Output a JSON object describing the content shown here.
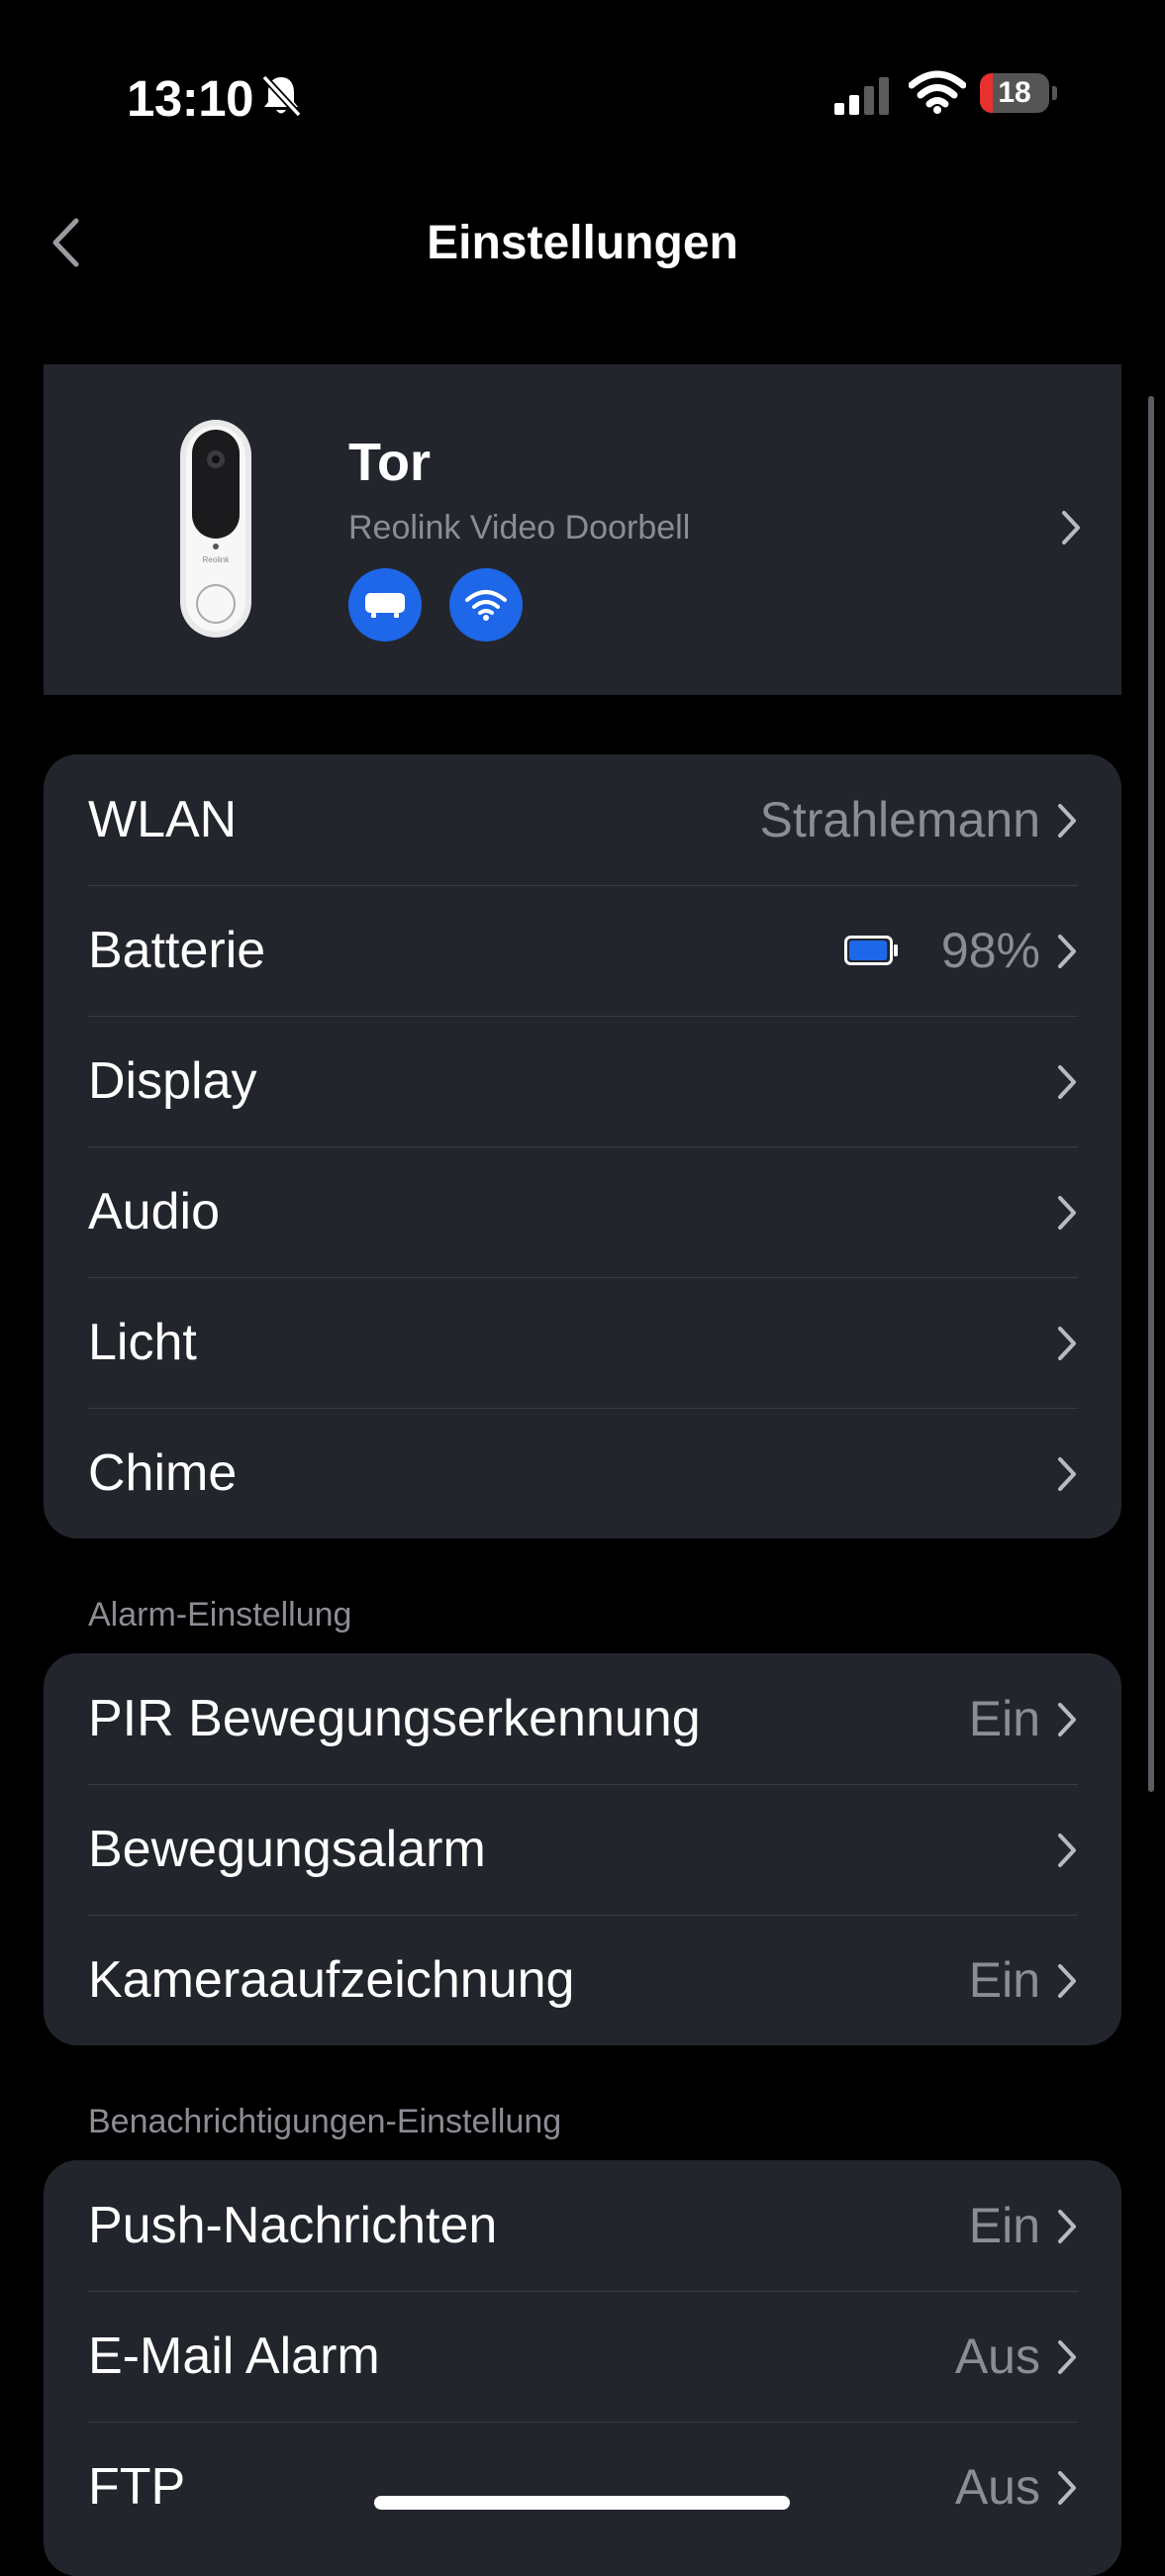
{
  "status_bar": {
    "time": "13:10",
    "battery_level": "18",
    "battery_fraction": 0.18,
    "battery_color": "#e8302e",
    "icons": [
      "bell-slash-icon",
      "cellular-signal-icon",
      "wifi-icon",
      "battery-icon"
    ]
  },
  "nav": {
    "title": "Einstellungen",
    "back_icon": "chevron-left-icon"
  },
  "device": {
    "name": "Tor",
    "model": "Reolink Video Doorbell",
    "image_brand": "Reolink",
    "badges": [
      "hub-icon",
      "wifi-icon"
    ],
    "badge_color": "#1d67e8"
  },
  "general": {
    "rows": [
      {
        "label": "WLAN",
        "value": "Strahlemann"
      },
      {
        "label": "Batterie",
        "value": "98%",
        "battery_fraction": 0.98
      },
      {
        "label": "Display",
        "value": ""
      },
      {
        "label": "Audio",
        "value": ""
      },
      {
        "label": "Licht",
        "value": ""
      },
      {
        "label": "Chime",
        "value": ""
      }
    ]
  },
  "alarm": {
    "header": "Alarm-Einstellung",
    "rows": [
      {
        "label": "PIR Bewegungserkennung",
        "value": "Ein"
      },
      {
        "label": "Bewegungsalarm",
        "value": ""
      },
      {
        "label": "Kameraaufzeichnung",
        "value": "Ein"
      }
    ]
  },
  "notifications": {
    "header": "Benachrichtigungen-Einstellung",
    "rows": [
      {
        "label": "Push-Nachrichten",
        "value": "Ein"
      },
      {
        "label": "E-Mail Alarm",
        "value": "Aus"
      },
      {
        "label": "FTP",
        "value": "Aus"
      }
    ]
  }
}
